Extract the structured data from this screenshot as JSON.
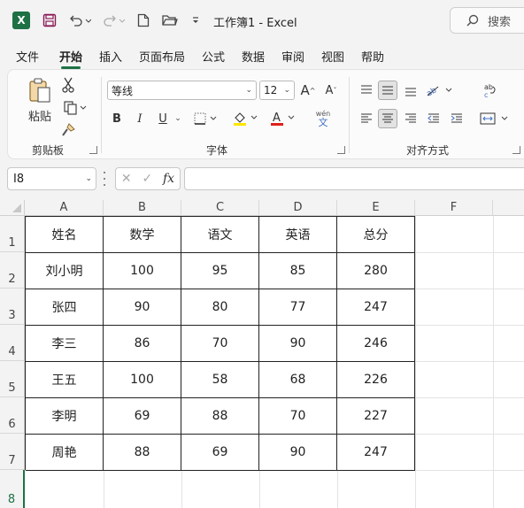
{
  "titlebar": {
    "excel_logo": "X",
    "save_icon": "save-icon",
    "undo_icon": "undo-icon",
    "redo_icon": "redo-icon",
    "new_icon": "new-file-icon",
    "open_icon": "folder-open-icon",
    "more_icon": "customize-icon",
    "doc_title": "工作簿1  -  Excel",
    "search_label": "搜索"
  },
  "tabs": [
    "文件",
    "开始",
    "插入",
    "页面布局",
    "公式",
    "数据",
    "审阅",
    "视图",
    "帮助"
  ],
  "active_tab": "开始",
  "ribbon": {
    "clipboard": {
      "label": "剪贴板",
      "paste_label": "粘贴"
    },
    "font": {
      "label": "字体",
      "font_name": "等线",
      "font_size": "12",
      "bold": "B",
      "italic": "I",
      "underline": "U",
      "grow": "A",
      "shrink": "A",
      "phonetic": "wén",
      "phonetic_sub": "文"
    },
    "alignment": {
      "label": "对齐方式"
    }
  },
  "formula_bar": {
    "name_box": "I8",
    "fx": "fx",
    "value": ""
  },
  "sheet": {
    "columns": [
      "A",
      "B",
      "C",
      "D",
      "E",
      "F"
    ],
    "rows": [
      "1",
      "2",
      "3",
      "4",
      "5",
      "6",
      "7",
      "8"
    ],
    "selected_row": "8",
    "table": [
      [
        "姓名",
        "数学",
        "语文",
        "英语",
        "总分"
      ],
      [
        "刘小明",
        "100",
        "95",
        "85",
        "280"
      ],
      [
        "张四",
        "90",
        "80",
        "77",
        "247"
      ],
      [
        "李三",
        "86",
        "70",
        "90",
        "246"
      ],
      [
        "王五",
        "100",
        "58",
        "68",
        "226"
      ],
      [
        "李明",
        "69",
        "88",
        "70",
        "227"
      ],
      [
        "周艳",
        "88",
        "69",
        "90",
        "247"
      ]
    ]
  },
  "colors": {
    "accent": "#1e7145"
  }
}
